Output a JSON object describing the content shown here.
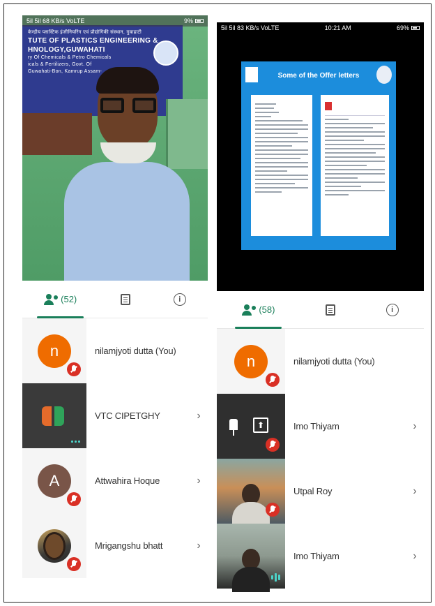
{
  "left_phone": {
    "status": {
      "left": "5il 5il 68 KB/s VoLTE",
      "time": "",
      "right": "9%"
    },
    "banner": {
      "line1": "केन्द्रीय प्लास्टिक इंजीनियरिंग एवं प्रौद्योगिकी संस्थान, गुवाहाटी",
      "line2": "TUTE OF PLASTICS ENGINEERING &",
      "line3": "HNOLOGY,GUWAHATI",
      "line4": "ry Of Chemicals & Petro Chemicals",
      "line5": "icals & Fertilizers, Govt. Of",
      "line6": "Guwahati-Bon, Kamrup Assam-"
    },
    "tabs": [
      {
        "count": "(52)"
      },
      {},
      {
        "glyph": "i"
      }
    ],
    "participants": [
      {
        "name": "nilamjyoti dutta (You)",
        "initial": "n",
        "color": "#ef6c00"
      },
      {
        "name": "VTC CIPETGHY",
        "chevron": "›"
      },
      {
        "name": "Attwahira Hoque",
        "initial": "A",
        "color": "#795548",
        "chevron": "›"
      },
      {
        "name": "Mrigangshu bhatt",
        "chevron": "›"
      }
    ]
  },
  "right_phone": {
    "status": {
      "left": "5il 5il 83 KB/s VoLTE",
      "time": "10:21 AM",
      "right": "69%"
    },
    "slide": {
      "title": "Some of the Offer letters"
    },
    "tabs": [
      {
        "count": "(58)"
      },
      {},
      {
        "glyph": "i"
      }
    ],
    "participants": [
      {
        "name": "nilamjyoti dutta (You)",
        "initial": "n",
        "color": "#ef6c00"
      },
      {
        "name": "Imo Thiyam",
        "chevron": "›",
        "present_glyph": "⬆"
      },
      {
        "name": "Utpal Roy",
        "chevron": "›"
      },
      {
        "name": "Imo Thiyam",
        "chevron": "›"
      }
    ]
  },
  "colors": {
    "accent": "#1a7f5a",
    "mic_off": "#d93025",
    "slide_bg": "#1c8ddc"
  },
  "icons": [
    "people-icon",
    "chat-icon",
    "info-icon",
    "mic-off-icon",
    "chevron-right-icon",
    "pin-icon",
    "present-screen-icon",
    "battery-icon"
  ]
}
